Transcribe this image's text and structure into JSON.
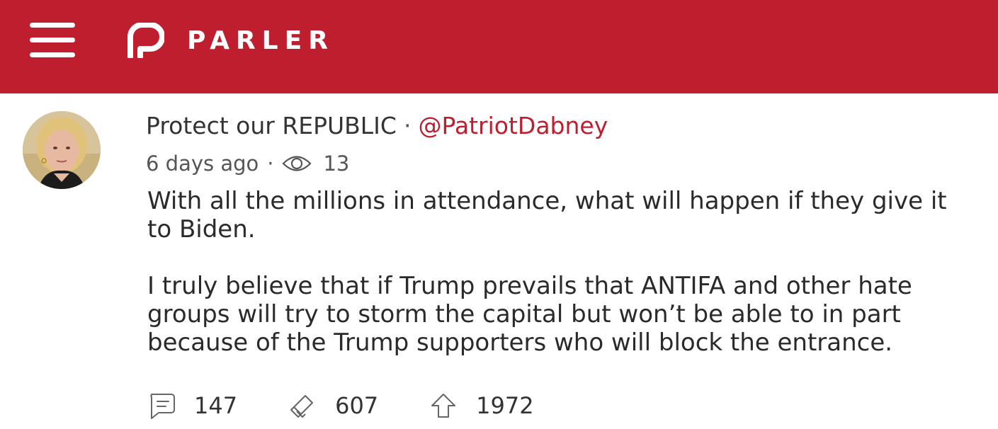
{
  "app": {
    "brand": "PARLER",
    "brand_color": "#bf1e2e",
    "menu_icon": "hamburger-menu-icon",
    "logo_icon": "parler-logo-icon"
  },
  "post": {
    "author_name": "Protect our REPUBLIC",
    "separator": "·",
    "handle": "@PatriotDabney",
    "time_ago": "6 days ago",
    "views_icon": "eye-icon",
    "views": "13",
    "body": [
      "With all the millions in attendance, what will happen if they give it to Biden.",
      "I truly believe that if Trump prevails that ANTIFA and other hate groups will try to storm the capital but won’t be able to in part because of the Trump supporters who will block the entrance."
    ],
    "actions": {
      "comments": {
        "icon": "comment-icon",
        "count": "147"
      },
      "echoes": {
        "icon": "megaphone-icon",
        "count": "607"
      },
      "upvotes": {
        "icon": "upvote-arrow-icon",
        "count": "1972"
      }
    }
  }
}
